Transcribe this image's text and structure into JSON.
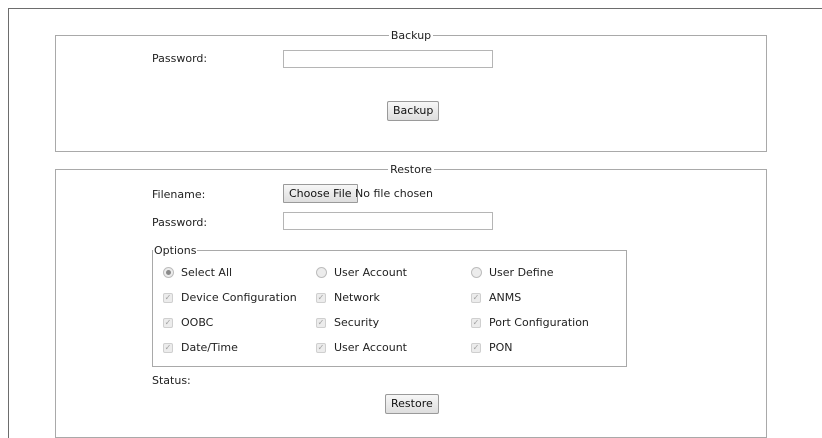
{
  "backup": {
    "legend": "Backup",
    "password_label": "Password:",
    "password_value": "",
    "button_label": "Backup"
  },
  "restore": {
    "legend": "Restore",
    "filename_label": "Filename:",
    "choose_file_label": "Choose File",
    "file_status": "No file chosen",
    "password_label": "Password:",
    "password_value": "",
    "status_label": "Status:",
    "button_label": "Restore"
  },
  "options": {
    "legend": "Options",
    "radios": [
      {
        "label": "Select All",
        "checked": true
      },
      {
        "label": "User Account",
        "checked": false
      },
      {
        "label": "User Define",
        "checked": false
      }
    ],
    "checkboxes": [
      {
        "label": "Device Configuration",
        "checked": true
      },
      {
        "label": "Network",
        "checked": true
      },
      {
        "label": "ANMS",
        "checked": true
      },
      {
        "label": "OOBC",
        "checked": true
      },
      {
        "label": "Security",
        "checked": true
      },
      {
        "label": "Port Configuration",
        "checked": true
      },
      {
        "label": "Date/Time",
        "checked": true
      },
      {
        "label": "User Account",
        "checked": true
      },
      {
        "label": "PON",
        "checked": true
      }
    ]
  },
  "icons": {
    "checkbox_mark": "check-icon",
    "radio_dot": "radio-dot-icon"
  }
}
